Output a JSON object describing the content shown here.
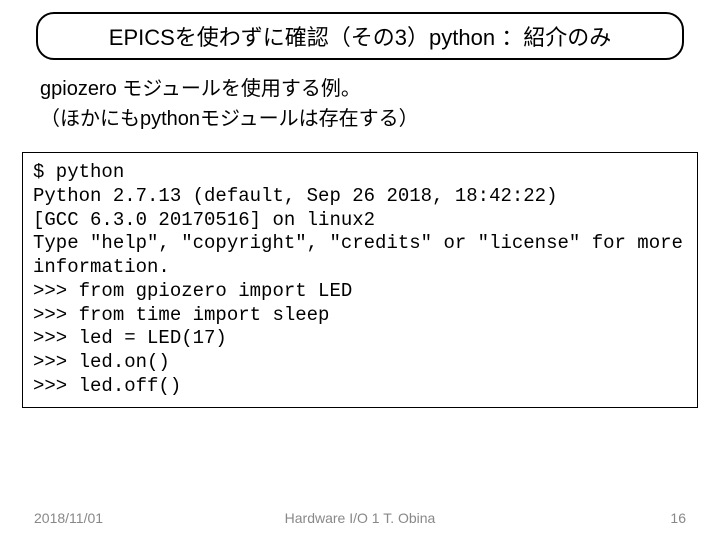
{
  "title": "EPICSを使わずに確認（その3）python ：紹介のみ",
  "intro_line1": "gpiozero モジュールを使用する例。",
  "intro_line2": "（ほかにもpythonモジュールは存在する）",
  "code": "$ python\nPython 2.7.13 (default, Sep 26 2018, 18:42:22)\n[GCC 6.3.0 20170516] on linux2\nType \"help\", \"copyright\", \"credits\" or \"license\" for more information.\n>>> from gpiozero import LED\n>>> from time import sleep\n>>> led = LED(17)\n>>> led.on()\n>>> led.off()",
  "footer": {
    "date": "2018/11/01",
    "center": "Hardware I/O 1 T. Obina",
    "page": "16"
  }
}
